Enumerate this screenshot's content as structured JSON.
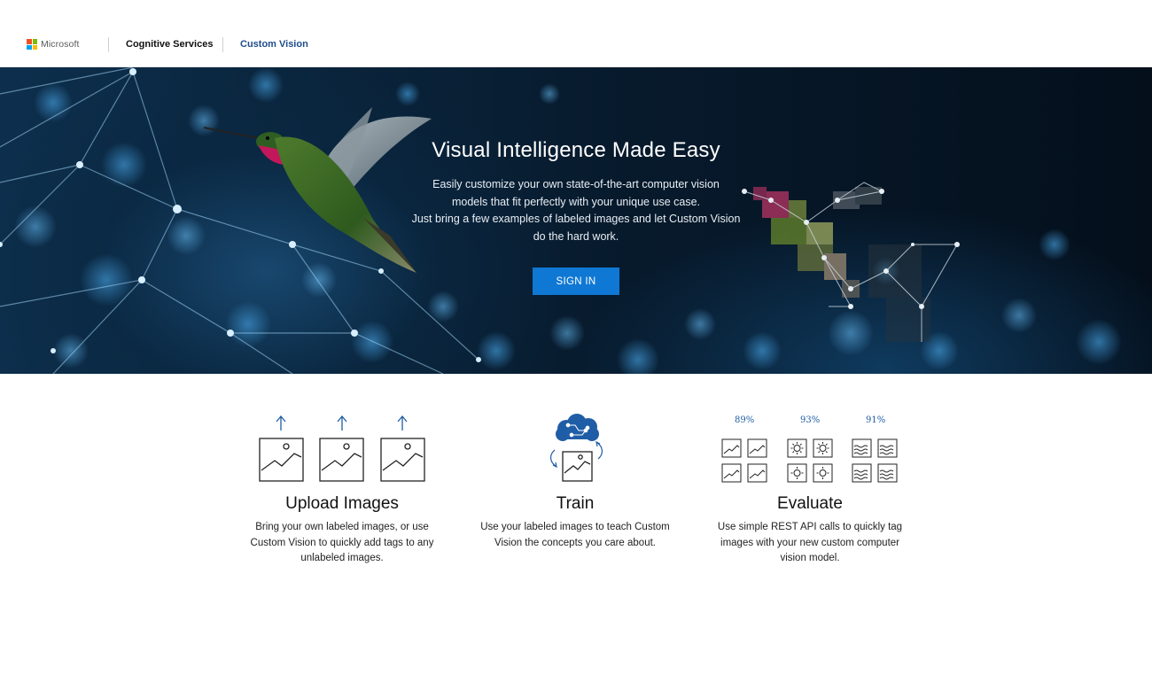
{
  "header": {
    "brand": "Microsoft",
    "nav": [
      {
        "label": "Cognitive Services"
      },
      {
        "label": "Custom Vision"
      }
    ],
    "colors": {
      "brand_red": "#f25022",
      "brand_green": "#7fba00",
      "brand_blue": "#00a4ef",
      "brand_yellow": "#ffb900",
      "active_link": "#1e4d8c"
    }
  },
  "hero": {
    "title": "Visual Intelligence Made Easy",
    "description_lines": [
      "Easily customize your own state-of-the-art computer vision",
      "models that fit perfectly with your unique use case.",
      "Just bring a few examples of labeled images and let Custom Vision",
      "do the hard work."
    ],
    "signin_label": "SIGN IN",
    "accent": "#0f78d4"
  },
  "features": [
    {
      "icon": "upload-images-icon",
      "title": "Upload Images",
      "description_lines": [
        "Bring your own labeled images, or use",
        "Custom Vision to quickly add tags to any",
        "unlabeled images."
      ]
    },
    {
      "icon": "brain-circuit-icon",
      "title": "Train",
      "description_lines": [
        "Use your labeled images to teach Custom",
        "Vision the concepts you care about."
      ]
    },
    {
      "icon": "evaluate-grid-icon",
      "title": "Evaluate",
      "description_lines": [
        "Use simple REST API calls to quickly tag",
        "images with your new custom computer",
        "vision model."
      ],
      "scores": [
        "89%",
        "93%",
        "91%"
      ]
    }
  ]
}
